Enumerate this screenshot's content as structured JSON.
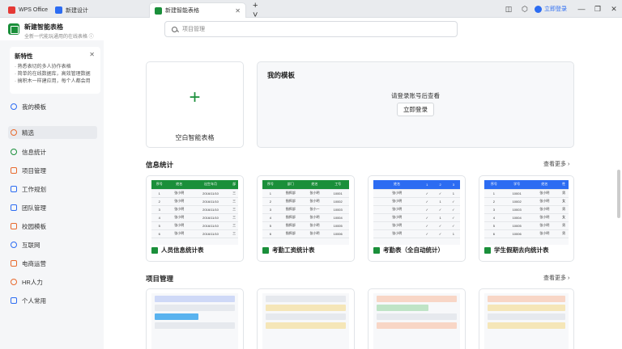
{
  "tabs": [
    {
      "label": "WPS Office",
      "color": "#e53935"
    },
    {
      "label": "新建设计",
      "color": "#2c6cf2"
    },
    {
      "label": "新建智能表格",
      "color": "#1a8f3a"
    }
  ],
  "topbar": {
    "login": "立即登录"
  },
  "app": {
    "title": "新建智能表格",
    "subtitle": "全新一代能玩通用的在线表格 ⓘ"
  },
  "search": {
    "placeholder": "项目管理"
  },
  "new_features": {
    "title": "新特性",
    "lines": [
      "· 熟悉表切的多人协作表格",
      "· 简单的在线数据库，高效管理数据",
      "· 搞积木一样建应用，每个人都会用"
    ]
  },
  "sidebar": {
    "items": [
      {
        "label": "我的模板",
        "color": "#2c6cf2"
      },
      {
        "label": "精选",
        "color": "#e8692c"
      },
      {
        "label": "信息统计",
        "color": "#1a8f3a"
      },
      {
        "label": "项目管理",
        "color": "#e8692c"
      },
      {
        "label": "工作规划",
        "color": "#2c6cf2"
      },
      {
        "label": "团队管理",
        "color": "#2c6cf2"
      },
      {
        "label": "校园模板",
        "color": "#e8692c"
      },
      {
        "label": "互联网",
        "color": "#2c6cf2"
      },
      {
        "label": "电商运营",
        "color": "#e8692c"
      },
      {
        "label": "HR人力",
        "color": "#e8692c"
      },
      {
        "label": "个人常用",
        "color": "#2c6cf2"
      }
    ]
  },
  "blank": {
    "label": "空白智能表格"
  },
  "my_templates": {
    "title": "我的模板",
    "message": "请登录账号后查看",
    "button": "立即登录"
  },
  "info_section": {
    "title": "信息统计",
    "more": "查看更多 ›",
    "cards": [
      {
        "name": "人员信息统计表",
        "header": [
          "序号",
          "姓名",
          "出生年月",
          "部"
        ],
        "rows": [
          [
            "1",
            "张小明",
            "2016/11/10",
            "三"
          ],
          [
            "2",
            "张小明",
            "2016/11/10",
            "三"
          ],
          [
            "3",
            "张小明",
            "2016/11/10",
            "三"
          ],
          [
            "4",
            "张小明",
            "2016/11/10",
            "三"
          ],
          [
            "5",
            "张小明",
            "2016/11/10",
            "三"
          ],
          [
            "6",
            "张小明",
            "2016/11/10",
            "三"
          ]
        ]
      },
      {
        "name": "考勤工资统计表",
        "header": [
          "序号",
          "部门",
          "姓名",
          "工号"
        ],
        "rows": [
          [
            "1",
            "指挥部",
            "张小明",
            "10001"
          ],
          [
            "2",
            "指挥部",
            "张小明",
            "10002"
          ],
          [
            "3",
            "指挥部",
            "张小一",
            "10003"
          ],
          [
            "4",
            "指挥部",
            "张小明",
            "10004"
          ],
          [
            "5",
            "指挥部",
            "张小明",
            "10005"
          ],
          [
            "6",
            "指挥部",
            "张小明",
            "10006"
          ]
        ]
      },
      {
        "name": "考勤表（全自动统计）",
        "header": [
          "姓名",
          "1",
          "2",
          "3"
        ],
        "rows": [
          [
            "张小明",
            "✓",
            "✓",
            "1"
          ],
          [
            "张小明",
            "✓",
            "1",
            "✓"
          ],
          [
            "张小明",
            "✓",
            "✓",
            "✓"
          ],
          [
            "张小明",
            "✓",
            "1",
            "✓"
          ],
          [
            "张小明",
            "✓",
            "✓",
            "✓"
          ],
          [
            "张小明",
            "✓",
            "✓",
            "1"
          ]
        ]
      },
      {
        "name": "学生假期去向统计表",
        "header": [
          "序号",
          "学号",
          "姓名",
          "性"
        ],
        "rows": [
          [
            "1",
            "10001",
            "张小明",
            "男"
          ],
          [
            "2",
            "10002",
            "张小明",
            "女"
          ],
          [
            "3",
            "10003",
            "张小明",
            "男"
          ],
          [
            "4",
            "10004",
            "张小明",
            "女"
          ],
          [
            "5",
            "10005",
            "张小明",
            "男"
          ],
          [
            "6",
            "10006",
            "张小明",
            "男"
          ]
        ]
      }
    ]
  },
  "pm_section": {
    "title": "项目管理",
    "more": "查看更多 ›"
  },
  "colors": {
    "green": "#1a8f3a",
    "blue": "#2c6cf2",
    "orange": "#e8692c"
  }
}
